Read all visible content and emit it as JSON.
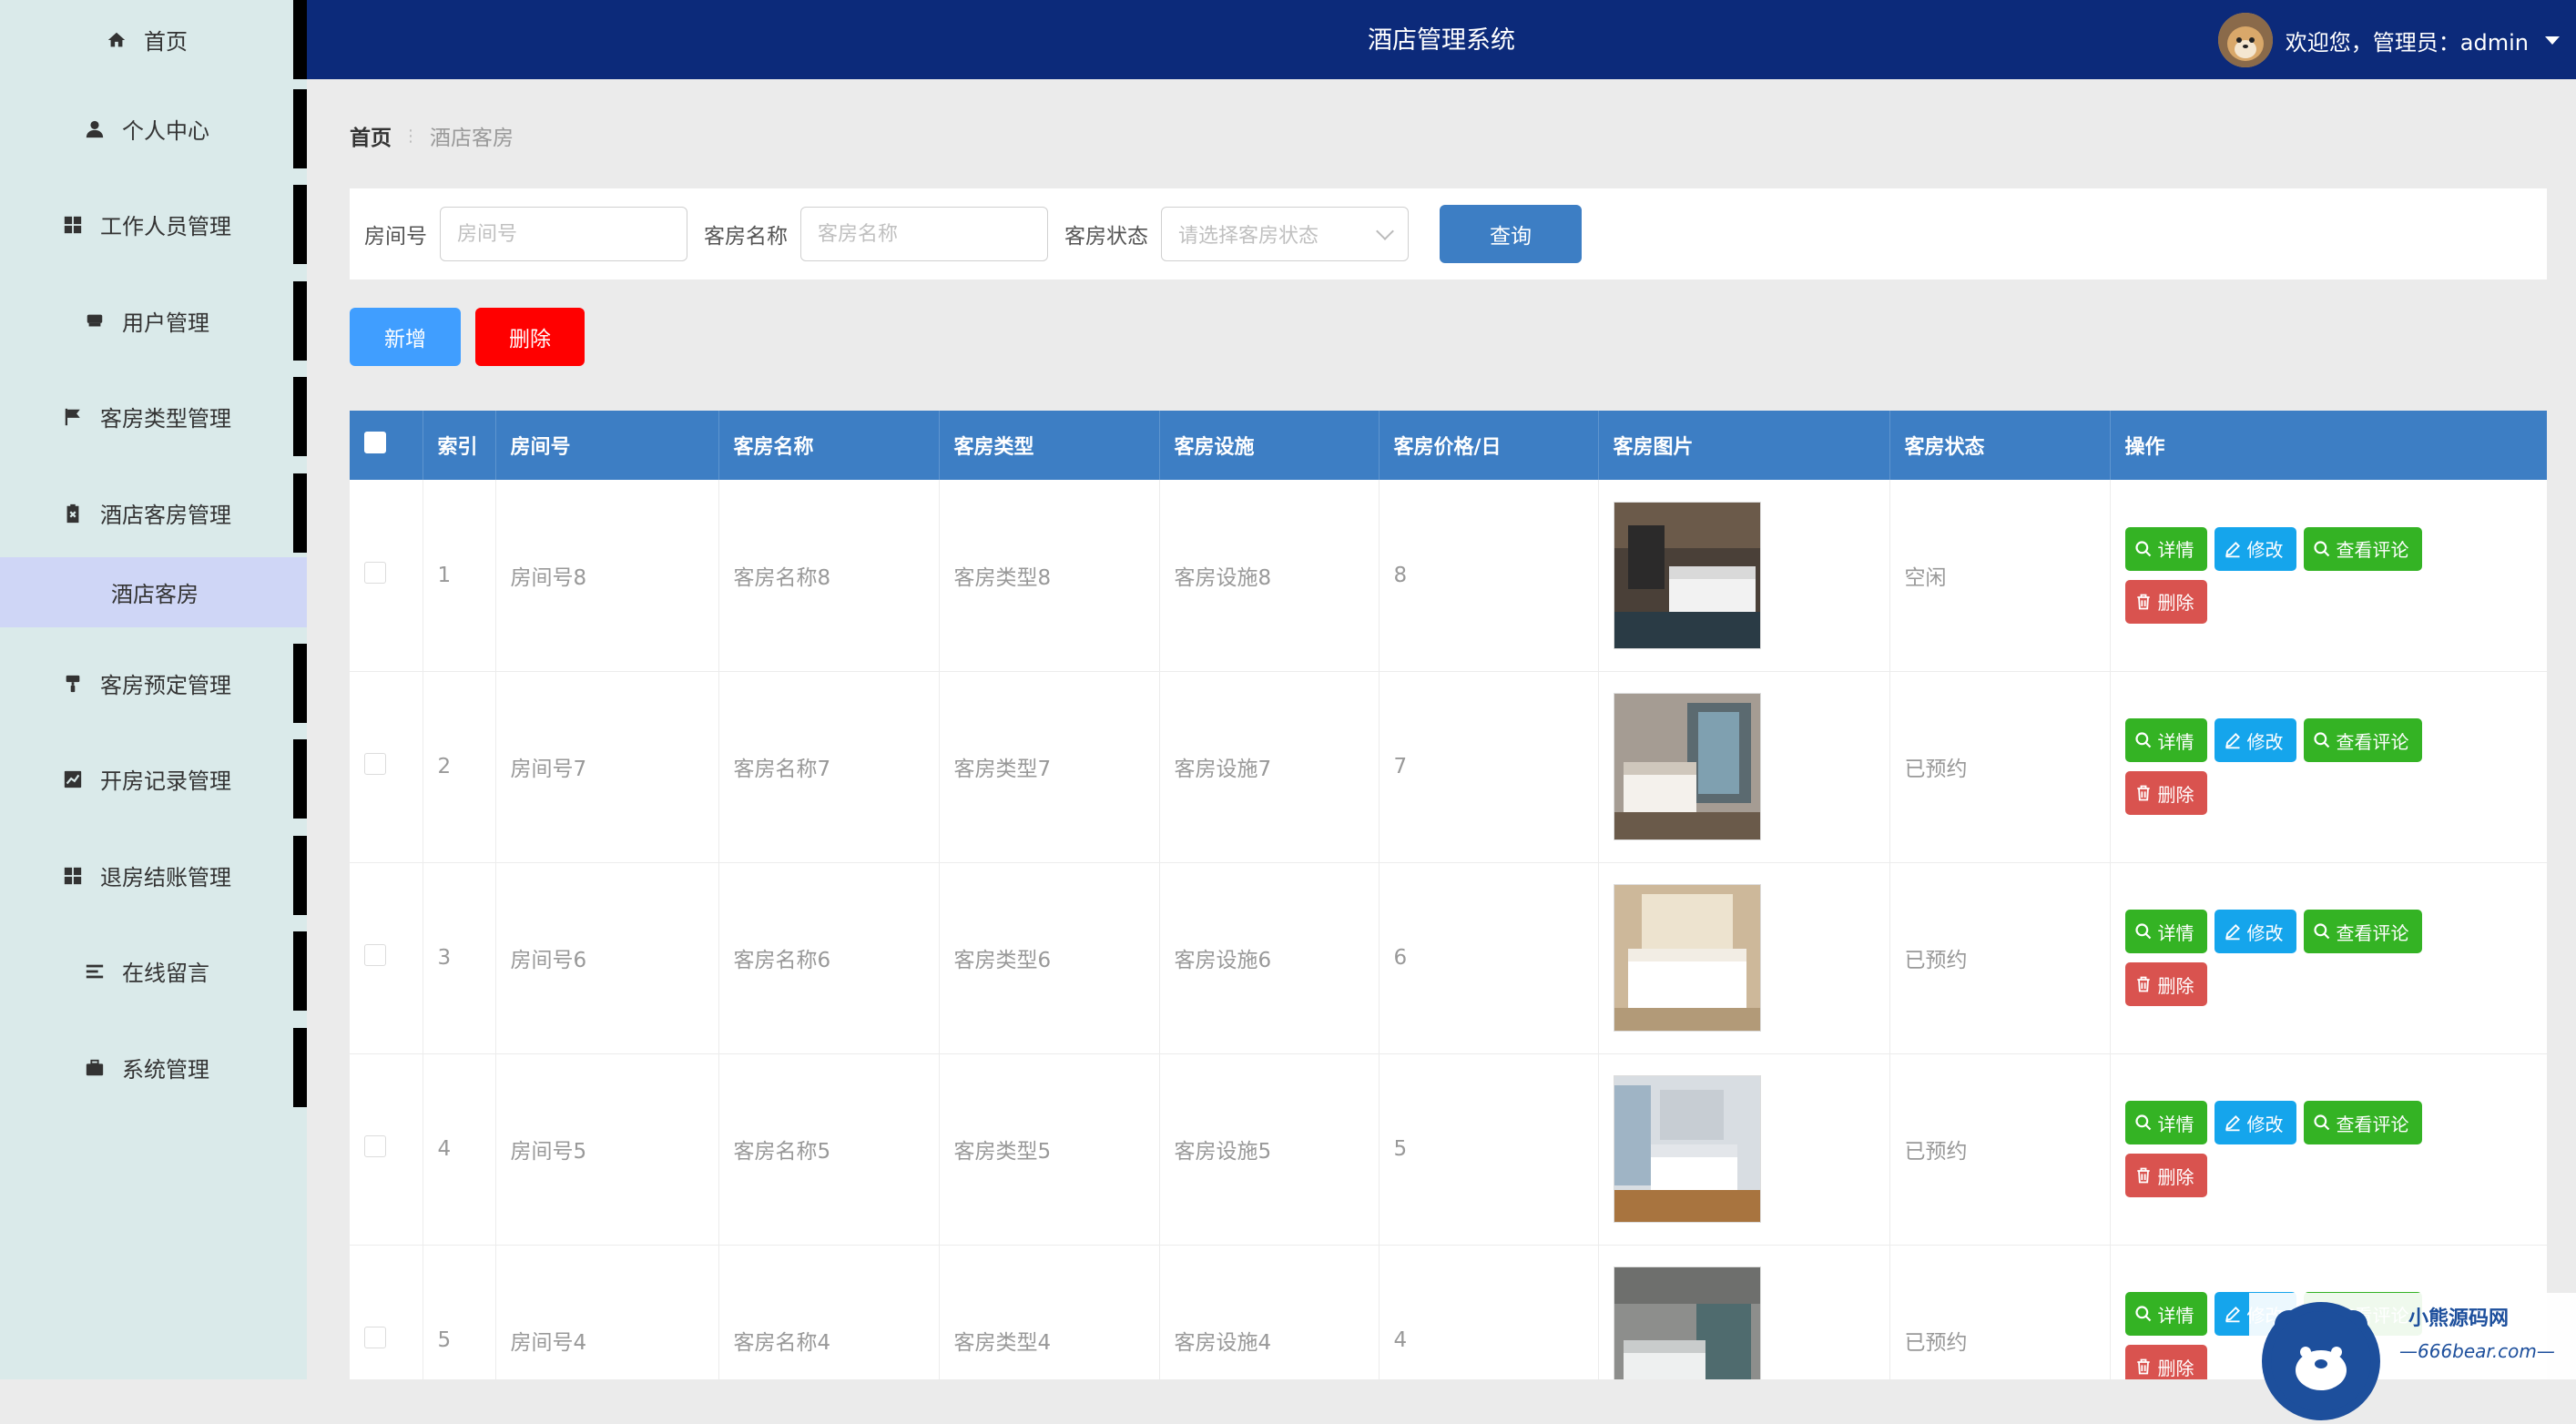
{
  "header": {
    "title": "酒店管理系统",
    "welcome": "欢迎您，管理员：admin"
  },
  "sidebar": {
    "items": [
      {
        "label": "首页",
        "icon": "home-icon"
      },
      {
        "label": "个人中心",
        "icon": "user-icon"
      },
      {
        "label": "工作人员管理",
        "icon": "grid-icon"
      },
      {
        "label": "用户管理",
        "icon": "bed-icon"
      },
      {
        "label": "客房类型管理",
        "icon": "flag-icon"
      },
      {
        "label": "酒店客房管理",
        "icon": "clipboard-icon"
      },
      {
        "label": "客房预定管理",
        "icon": "paint-roller-icon"
      },
      {
        "label": "开房记录管理",
        "icon": "chart-icon"
      },
      {
        "label": "退房结账管理",
        "icon": "grid-icon"
      },
      {
        "label": "在线留言",
        "icon": "list-icon"
      },
      {
        "label": "系统管理",
        "icon": "briefcase-icon"
      }
    ],
    "active_sub": "酒店客房"
  },
  "breadcrumb": {
    "home": "首页",
    "current": "酒店客房"
  },
  "search": {
    "room_no_label": "房间号",
    "room_no_placeholder": "房间号",
    "room_name_label": "客房名称",
    "room_name_placeholder": "客房名称",
    "status_label": "客房状态",
    "status_placeholder": "请选择客房状态",
    "query_label": "查询"
  },
  "actions": {
    "add": "新增",
    "delete": "删除"
  },
  "table": {
    "columns": [
      "索引",
      "房间号",
      "客房名称",
      "客房类型",
      "客房设施",
      "客房价格/日",
      "客房图片",
      "客房状态",
      "操作"
    ],
    "op_labels": {
      "detail": "详情",
      "edit": "修改",
      "review": "查看评论",
      "delete": "删除"
    },
    "rows": [
      {
        "index": "1",
        "room_no": "房间号8",
        "name": "客房名称8",
        "type": "客房类型8",
        "facility": "客房设施8",
        "price": "8",
        "status": "空闲"
      },
      {
        "index": "2",
        "room_no": "房间号7",
        "name": "客房名称7",
        "type": "客房类型7",
        "facility": "客房设施7",
        "price": "7",
        "status": "已预约"
      },
      {
        "index": "3",
        "room_no": "房间号6",
        "name": "客房名称6",
        "type": "客房类型6",
        "facility": "客房设施6",
        "price": "6",
        "status": "已预约"
      },
      {
        "index": "4",
        "room_no": "房间号5",
        "name": "客房名称5",
        "type": "客房类型5",
        "facility": "客房设施5",
        "price": "5",
        "status": "已预约"
      },
      {
        "index": "5",
        "room_no": "房间号4",
        "name": "客房名称4",
        "type": "客房类型4",
        "facility": "客房设施4",
        "price": "4",
        "status": "已预约"
      }
    ]
  },
  "watermark": {
    "title": "小熊源码网",
    "url": "—666bear.com—"
  },
  "colors": {
    "header_bg": "#0c2a7a",
    "sidebar_bg": "#daeaea",
    "table_header": "#3d7ec4",
    "btn_add": "#409eff",
    "btn_delete": "#ff0000",
    "op_green": "#34b324",
    "op_blue": "#15a5ec",
    "op_red": "#d9534f"
  }
}
